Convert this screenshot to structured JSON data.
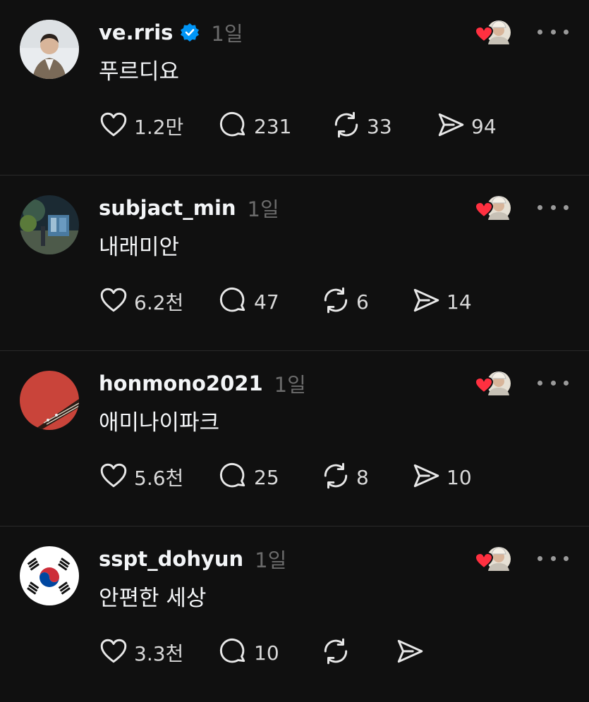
{
  "colors": {
    "background": "#101010",
    "text": "#f3f5f7",
    "muted": "#6b6b6b",
    "heart": "#ff3040",
    "verified": "#0095f6"
  },
  "posts": [
    {
      "username": "ve.rris",
      "verified": true,
      "time": "1일",
      "text": "푸르디요",
      "avatar": "person-photo-avatar",
      "likes": "1.2만",
      "replies": "231",
      "reposts": "33",
      "shares": "94",
      "action_positions": [
        140,
        310,
        470,
        618
      ]
    },
    {
      "username": "subjact_min",
      "verified": false,
      "time": "1일",
      "text": "내래미안",
      "avatar": "night-scene-avatar",
      "likes": "6.2천",
      "replies": "47",
      "reposts": "6",
      "shares": "14",
      "action_positions": [
        140,
        310,
        455,
        583
      ]
    },
    {
      "username": "honmono2021",
      "verified": false,
      "time": "1일",
      "text": "애미나이파크",
      "avatar": "guitar-avatar",
      "likes": "5.6천",
      "replies": "25",
      "reposts": "8",
      "shares": "10",
      "action_positions": [
        140,
        310,
        455,
        583
      ]
    },
    {
      "username": "sspt_dohyun",
      "verified": false,
      "time": "1일",
      "text": "안편한 세상",
      "avatar": "korean-flag-avatar",
      "likes": "3.3천",
      "replies": "10",
      "reposts": "",
      "shares": "",
      "action_positions": [
        140,
        310,
        455,
        560
      ]
    }
  ]
}
